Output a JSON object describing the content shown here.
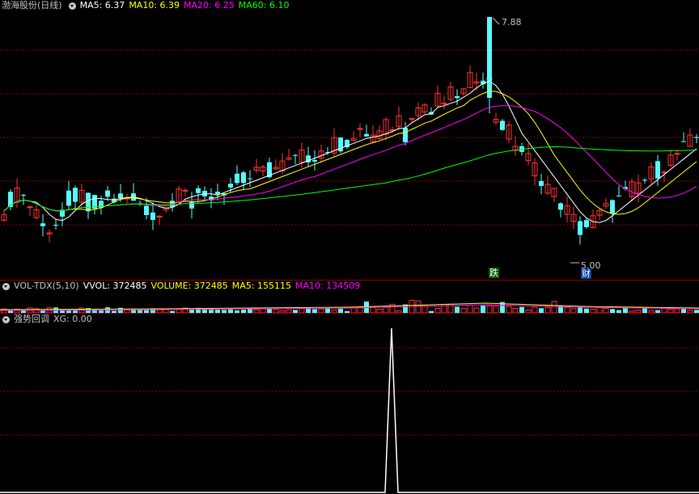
{
  "main": {
    "title": "渤海股份(日线)",
    "ma": [
      {
        "label": "MA5: 6.37",
        "color": "#ffffff"
      },
      {
        "label": "MA10: 6.39",
        "color": "#ffff00"
      },
      {
        "label": "MA20: 6.25",
        "color": "#ff00ff"
      },
      {
        "label": "MA60: 6.10",
        "color": "#00ff00"
      }
    ],
    "high_label": "7.88",
    "low_label": "5.00",
    "badge_die": "跌",
    "badge_cai": "财"
  },
  "volume": {
    "name": "VOL-TDX(5,10)",
    "vvol": "VVOL: 372485",
    "volume": "VOLUME: 372485",
    "ma5": "MA5: 155115",
    "ma10": "MA10: 134509"
  },
  "indicator": {
    "name": "强势回调",
    "xg": "XG: 0.00"
  },
  "colors": {
    "up": "#ff3232",
    "down": "#54ffff",
    "ma5": "#ffffff",
    "ma10": "#ffff00",
    "ma20": "#ff00ff",
    "ma60": "#00ff00",
    "grid": "#8b0000",
    "text": "#c0c0c0"
  },
  "chart_data": {
    "type": "candlestick",
    "high": 7.88,
    "low": 5.0,
    "ma5_last": 6.37,
    "ma10_last": 6.39,
    "ma20_last": 6.25,
    "ma60_last": 6.1,
    "volume_last": 372485,
    "vol_ma5": 155115,
    "vol_ma10": 134509,
    "xg_last": 0.0
  }
}
